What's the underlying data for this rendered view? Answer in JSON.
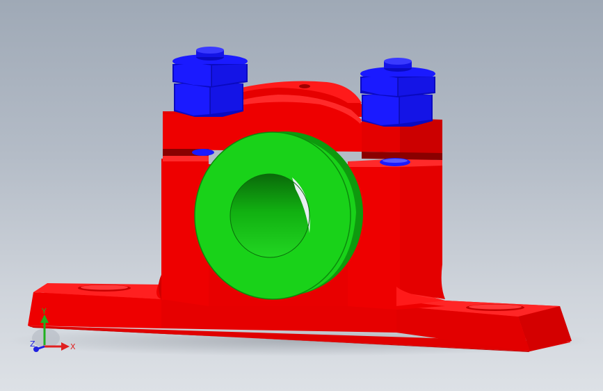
{
  "viewport": {
    "model": "pillow-block-bearing",
    "colors": {
      "housing": "#ff0000",
      "housing_shade": "#c80000",
      "housing_dark": "#a00000",
      "bearing": "#19d219",
      "bearing_shade": "#0e9a0e",
      "bearing_dark": "#087008",
      "fastener": "#1a1aff",
      "fastener_shade": "#0a0ac0",
      "fastener_dark": "#05058a"
    }
  },
  "triad": {
    "x_label": "X",
    "y_label": "Y",
    "z_label": "Z",
    "x_color": "#e02020",
    "y_color": "#20b020",
    "z_color": "#2020e0"
  }
}
